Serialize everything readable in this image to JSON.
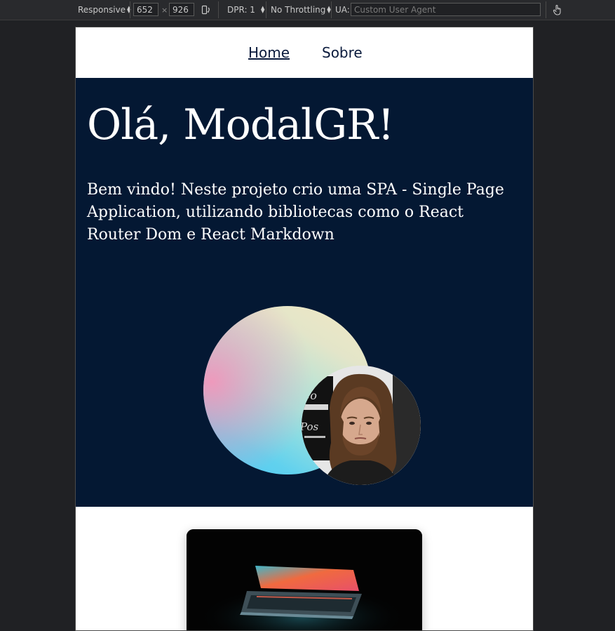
{
  "devtools": {
    "device_mode": "Responsive",
    "width": "652",
    "times": "×",
    "height": "926",
    "dpr": "DPR: 1",
    "throttling": "No Throttling",
    "ua_label": "UA:",
    "ua_placeholder": "Custom User Agent"
  },
  "nav": {
    "home": "Home",
    "about": "Sobre"
  },
  "hero": {
    "title": "Olá, ModalGR!",
    "text": "Bem vindo! Neste projeto crio uma SPA - Single Page Application, utilizando bibliotecas como o React Router Dom e React Markdown"
  },
  "colors": {
    "hero_bg": "#041833",
    "nav_text": "#0a1a3c",
    "toolbar_bg": "#292a2d",
    "page_bg": "#202124"
  },
  "icons": [
    "device-rotate-icon",
    "touch-hand-icon"
  ]
}
